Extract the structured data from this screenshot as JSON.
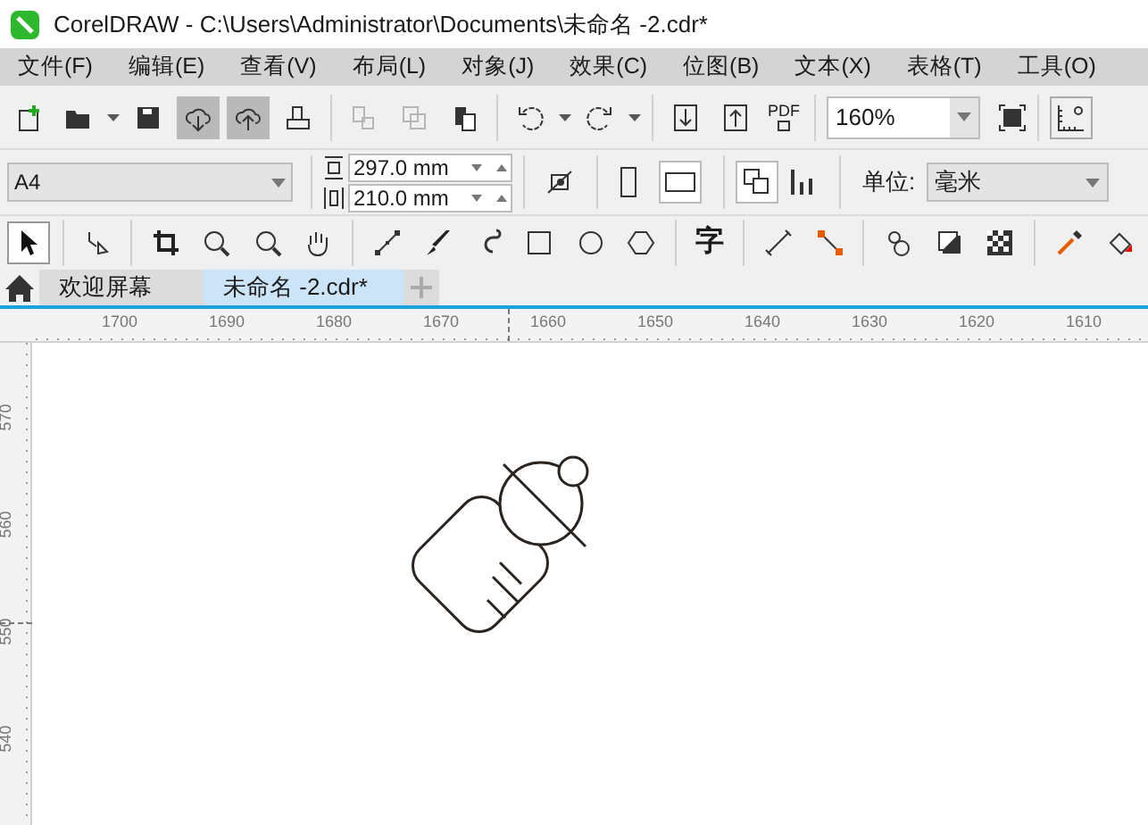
{
  "window": {
    "title": "CorelDRAW - C:\\Users\\Administrator\\Documents\\未命名 -2.cdr*"
  },
  "menu": [
    "文件(F)",
    "编辑(E)",
    "查看(V)",
    "布局(L)",
    "对象(J)",
    "效果(C)",
    "位图(B)",
    "文本(X)",
    "表格(T)",
    "工具(O)"
  ],
  "standard_toolbar": {
    "buttons": [
      {
        "pressed": false,
        "disabled": false
      },
      {
        "pressed": false,
        "disabled": false
      },
      {
        "pressed": false,
        "disabled": false
      },
      {
        "pressed": true,
        "disabled": false
      },
      {
        "pressed": true,
        "disabled": false
      },
      {
        "pressed": false,
        "disabled": false
      },
      {
        "pressed": false,
        "disabled": true
      },
      {
        "pressed": false,
        "disabled": true
      },
      {
        "pressed": false,
        "disabled": false
      },
      {
        "pressed": false,
        "disabled": false
      },
      {
        "pressed": false,
        "disabled": false
      },
      {
        "pressed": false,
        "disabled": false
      },
      {
        "pressed": false,
        "disabled": false
      }
    ],
    "pdf_label": "PDF",
    "zoom": "160%"
  },
  "property_bar": {
    "page_size": "A4",
    "width": "297.0 mm",
    "height": "210.0 mm",
    "unit_label": "单位:",
    "unit": "毫米"
  },
  "toolbox": {
    "tools": [
      {
        "selected": true
      },
      {
        "selected": false
      },
      {
        "selected": false
      },
      {
        "selected": false
      },
      {
        "selected": false
      },
      {
        "selected": false
      },
      {
        "selected": false
      },
      {
        "selected": false
      },
      {
        "selected": false
      },
      {
        "selected": false
      },
      {
        "selected": false
      },
      {
        "selected": false
      },
      {
        "selected": false
      },
      {
        "selected": false
      },
      {
        "selected": false
      },
      {
        "selected": false
      },
      {
        "selected": false
      },
      {
        "selected": false
      },
      {
        "selected": false
      },
      {
        "selected": false
      }
    ],
    "text_tool": "字"
  },
  "tabs": [
    {
      "label": "欢迎屏幕",
      "selected": false
    },
    {
      "label": "未命名 -2.cdr*",
      "selected": true
    }
  ],
  "rulers": {
    "horizontal": [
      "1700",
      "1690",
      "1680",
      "1670",
      "1660",
      "1650",
      "1640",
      "1630",
      "1620",
      "1610"
    ],
    "vertical": [
      "570",
      "560",
      "550",
      "540"
    ]
  }
}
